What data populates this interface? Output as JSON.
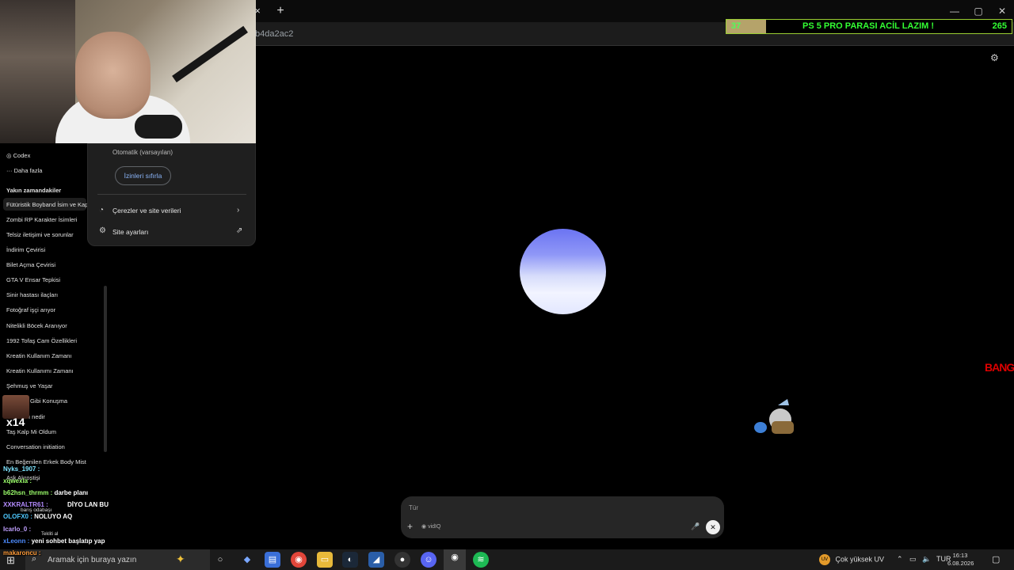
{
  "browser": {
    "tab_close": "×",
    "new_tab": "+",
    "url_fragment": "b4da2ac2",
    "window_controls": [
      "—",
      "▢",
      "✕"
    ]
  },
  "donation_bar": {
    "left_value": "37",
    "goal_text": "PS 5 PRO PARASI ACİL LAZIM !",
    "right_value": "265",
    "progress": 0.14
  },
  "sidebar": {
    "items_top": [
      {
        "icon": "codex-icon",
        "label": "Codex"
      },
      {
        "icon": "more-icon",
        "label": "Daha fazla"
      }
    ],
    "recent_heading": "Yakın zamandakiler",
    "recent": [
      "Fütüristik Boyband İsim ve Kap",
      "Zombi RP Karakter İsimleri",
      "Telsiz iletişimi ve sorunlar",
      "İndirim Çevirisi",
      "Bilet Açma Çevirisi",
      "GTA V Ensar Tepkisi",
      "Sinir hastası ilaçları",
      "Fotoğraf işçi arıyor",
      "Nitelikli Böcek Aranıyor",
      "1992 Tofaş Cam Özellikleri",
      "Kreatin Kullanım Zamanı",
      "Kreatin Kullanımı Zamanı",
      "Şehmuş ve Yaşar",
      "Gibi Konuşma",
      "ı nedir",
      "Taş Kalp Mi Oldum",
      "Conversation initiation",
      "En Beğenilen Erkek Body Mist",
      "Aşk Akrostişi"
    ]
  },
  "popup": {
    "mode_text": "Otomatik (varsayılan)",
    "reset_button": "İzinleri sıfırla",
    "cookies_label": "Çerezler ve site verileri",
    "site_settings_label": "Site ayarları"
  },
  "input": {
    "placeholder": "Tür",
    "plus": "+",
    "vidiq": "vidIQ",
    "send": "✕"
  },
  "chat": [
    {
      "user": "Nyks_1907 :",
      "msg": "",
      "color": "#7fe5ff"
    },
    {
      "user": "xqwexla :",
      "msg": "",
      "color": "#9cff6b"
    },
    {
      "user": "b62hsn_thrmm :",
      "msg": "darbe planı",
      "color": "#9cff6b"
    },
    {
      "user": "XXKRALTR61 :",
      "msg": "DİYO LAN BU",
      "color": "#b48cff"
    },
    {
      "user": "OLOFX0 :",
      "msg": "NOLUYO AQ",
      "color": "#4ec8ff"
    },
    {
      "user": "Icarlo_0 :",
      "msg": "",
      "color": "#c0a0ff"
    },
    {
      "user": "xLeonn :",
      "msg": "yeni sohbet başlatıp yap",
      "color": "#4d8cff"
    },
    {
      "user": "makaroncu :",
      "msg": "",
      "color": "#ff9c3a"
    }
  ],
  "chat_small": [
    "barış odabaşı",
    "Tekliti al"
  ],
  "overlay_emotes": {
    "x14": "x14",
    "bang": "BANG"
  },
  "taskbar": {
    "search_placeholder": "Aramak için buraya yazın",
    "weather": "Çok yüksek UV",
    "weather_badge": "UV",
    "language": "TUR",
    "time": "16:13",
    "date": "6.08.2026"
  }
}
